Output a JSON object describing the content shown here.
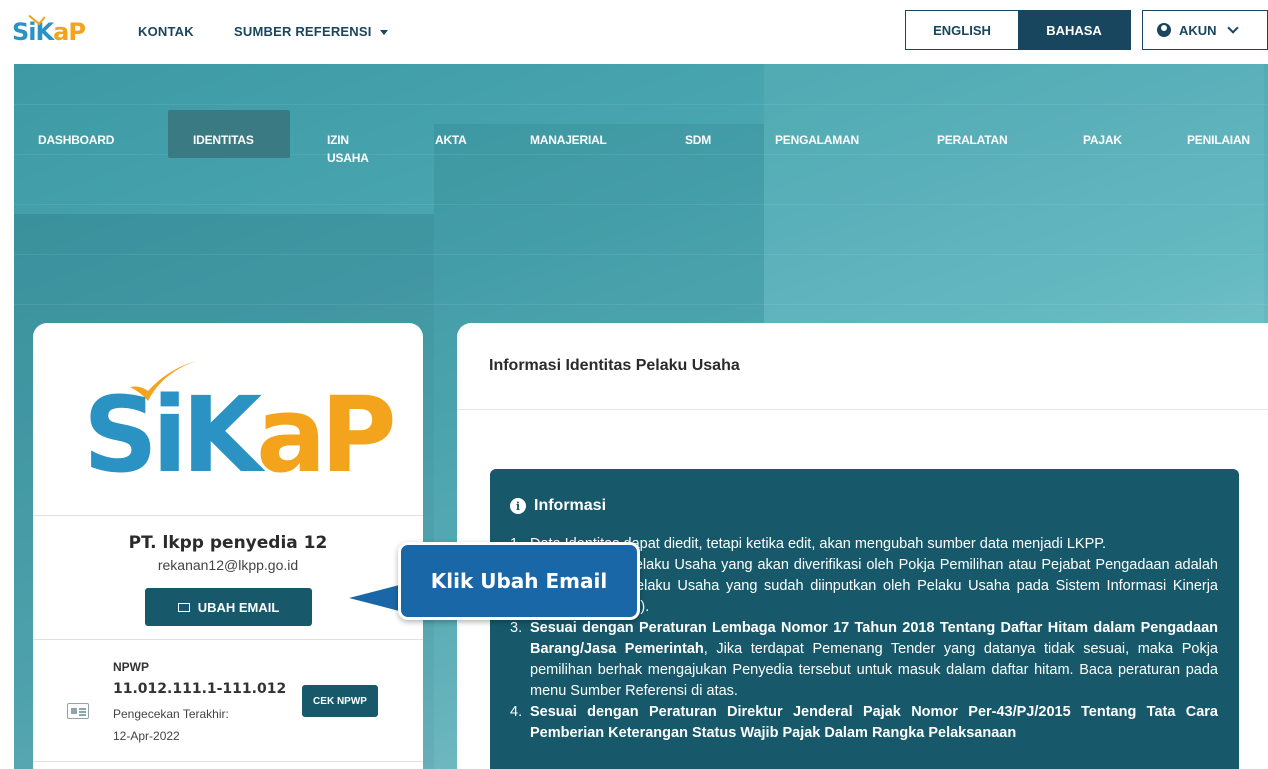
{
  "topbar": {
    "logo": "SiKaP",
    "nav": [
      {
        "label": "KONTAK"
      },
      {
        "label": "SUMBER REFERENSI"
      }
    ],
    "lang": {
      "english": "ENGLISH",
      "bahasa": "BAHASA",
      "active": "BAHASA"
    },
    "akun": "AKUN"
  },
  "mainnav": {
    "items": [
      {
        "label": "DASHBOARD"
      },
      {
        "label": "IDENTITAS"
      },
      {
        "label": "IZIN USAHA"
      },
      {
        "label": "AKTA"
      },
      {
        "label": "MANAJERIAL"
      },
      {
        "label": "SDM"
      },
      {
        "label": "PENGALAMAN"
      },
      {
        "label": "PERALATAN"
      },
      {
        "label": "PAJAK"
      },
      {
        "label": "PENILAIAN"
      }
    ],
    "active": "IDENTITAS"
  },
  "profile": {
    "logo": "SiKaP",
    "company": "PT. lkpp penyedia 12",
    "email": "rekanan12@lkpp.go.id",
    "ubah_email": "UBAH EMAIL",
    "npwp_label": "NPWP",
    "npwp_value": "11.012.111.1-111.012",
    "pengecekan_label": "Pengecekan Terakhir:",
    "pengecekan_date": "12-Apr-2022",
    "cek_npwp": "CEK NPWP"
  },
  "main": {
    "title": "Informasi Identitas Pelaku Usaha",
    "info_title": "Informasi",
    "items": [
      {
        "num": "1.",
        "text": "Data Identitas dapat diedit, tetapi ketika edit, akan mengubah sumber data menjadi LKPP."
      },
      {
        "num": "2.",
        "text": "Data Identitas Pelaku Usaha yang akan diverifikasi oleh Pokja Pemilihan atau Pejabat Pengadaan adalah data Identitas Pelaku Usaha yang sudah diinputkan oleh Pelaku Usaha pada Sistem Informasi Kinerja Penyedia (SIKaP)."
      },
      {
        "num": "3.",
        "bold": "Sesuai dengan Peraturan Lembaga Nomor 17 Tahun 2018 Tentang Daftar Hitam dalam Pengadaan Barang/Jasa Pemerintah",
        "text": ", Jika terdapat Pemenang Tender yang datanya tidak sesuai, maka Pokja pemilihan berhak mengajukan Penyedia tersebut untuk masuk dalam daftar hitam. Baca peraturan pada menu Sumber Referensi di atas."
      },
      {
        "num": "4.",
        "bold": "Sesuai dengan Peraturan Direktur Jenderal Pajak Nomor Per-43/PJ/2015 Tentang Tata Cara Pemberian Keterangan Status Wajib Pajak Dalam Rangka Pelaksanaan",
        "text": ""
      }
    ]
  },
  "callout": {
    "text": "Klik Ubah Email",
    "color": "#1a67a8"
  },
  "colors": {
    "primary": "#17596a",
    "navy": "#17465e",
    "logo_blue": "#2a93c4",
    "logo_orange": "#f3a31c"
  }
}
